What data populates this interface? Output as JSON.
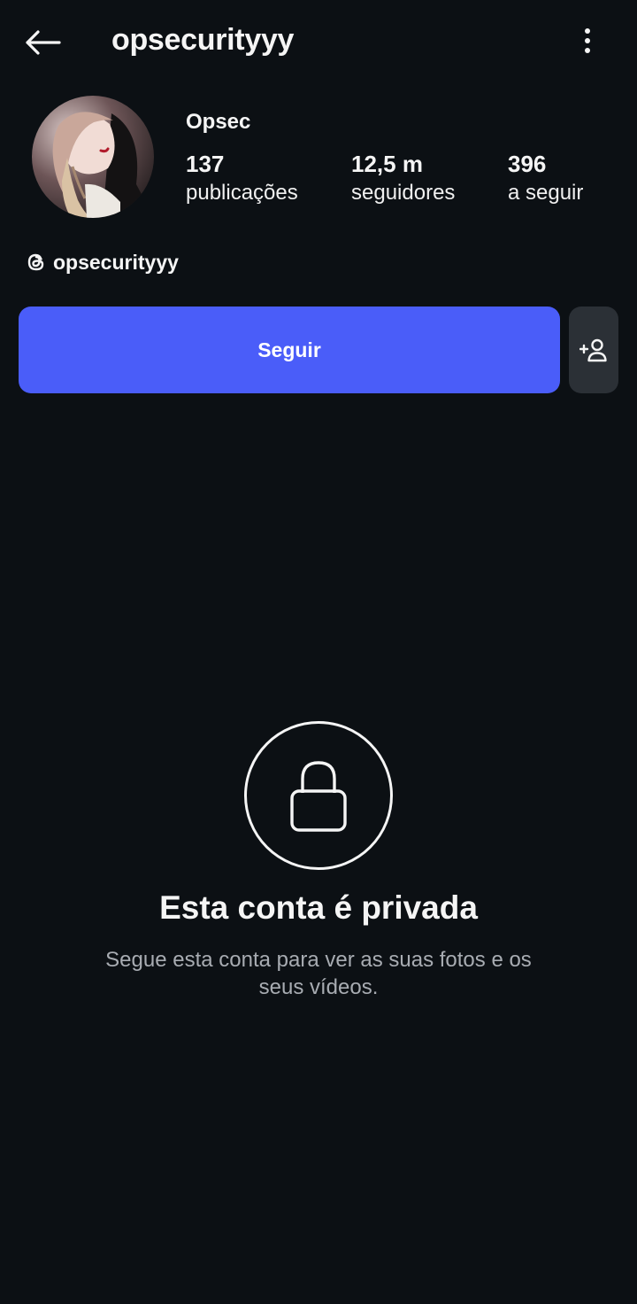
{
  "header": {
    "username": "opsecurityyy",
    "back_icon": "arrow-left-icon",
    "more_icon": "more-vertical-icon"
  },
  "profile": {
    "display_name": "Opsec",
    "avatar_icon": "profile-photo",
    "stats": [
      {
        "count": "137",
        "label": "publicações"
      },
      {
        "count": "12,5 m",
        "label": "seguidores"
      },
      {
        "count": "396",
        "label": "a seguir"
      }
    ],
    "threads_handle": "opsecurityyy",
    "threads_icon": "threads-icon"
  },
  "actions": {
    "follow_label": "Seguir",
    "follow_color": "#4a5df9",
    "suggest_icon": "add-person-icon"
  },
  "private_notice": {
    "icon": "lock-icon",
    "title": "Esta conta é privada",
    "subtitle": "Segue esta conta para ver as suas fotos e os seus vídeos."
  },
  "colors": {
    "background": "#0c1014",
    "secondary_button": "#2b3036",
    "muted_text": "#a8acb2"
  }
}
